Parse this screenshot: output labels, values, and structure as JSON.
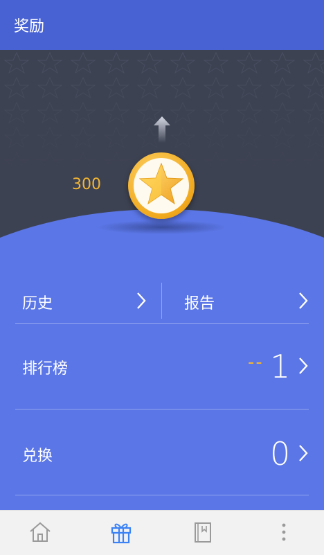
{
  "header": {
    "title": "奖励"
  },
  "hero": {
    "points": "300",
    "icons": [
      "up-arrow-icon",
      "star-icon"
    ]
  },
  "menu": {
    "history_label": "历史",
    "report_label": "报告",
    "leaderboard": {
      "label": "排行榜",
      "prefix": "--",
      "value": "1"
    },
    "redeem": {
      "label": "兑换",
      "value": "0"
    }
  },
  "bottom_nav": {
    "items": [
      {
        "icon": "home-icon",
        "active": false
      },
      {
        "icon": "gift-icon",
        "active": true
      },
      {
        "icon": "book-icon",
        "active": false
      },
      {
        "icon": "more-vertical-icon",
        "active": false
      }
    ]
  },
  "colors": {
    "header": "#4862d4",
    "hero_bg": "#3d4252",
    "panel": "#5b76e6",
    "accent_gold": "#f2b634",
    "active_nav": "#3b82f6",
    "inactive_nav": "#9a9a9a"
  }
}
